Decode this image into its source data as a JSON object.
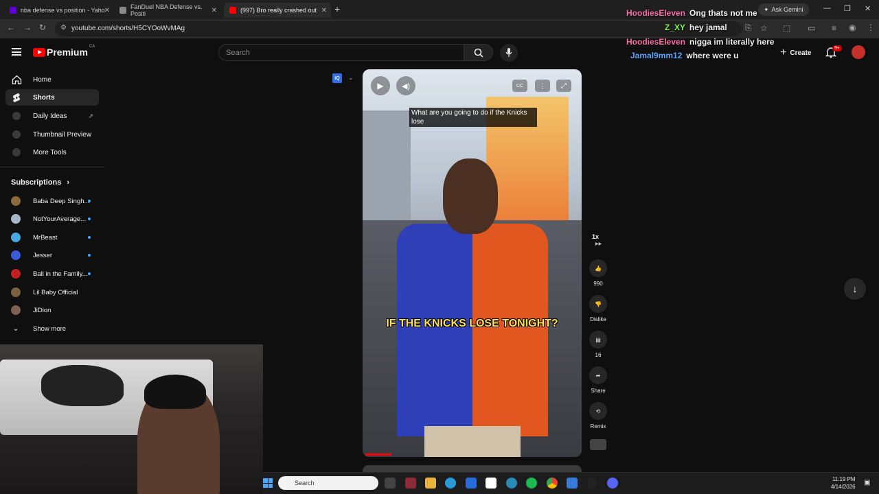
{
  "browser": {
    "tabs": [
      {
        "label": "nba defense vs position - Yaho",
        "color": "#6001d2"
      },
      {
        "label": "FanDuel NBA Defense vs. Positi",
        "color": "#888888"
      },
      {
        "label": "(997) Bro really crashed out",
        "color": "#ff0000"
      }
    ],
    "url": "youtube.com/shorts/H5CYOoWvMAg",
    "gemini_label": "Ask Gemini"
  },
  "youtube": {
    "logo_text": "Premium",
    "logo_region": "CA",
    "search_placeholder": "Search",
    "create_label": "Create",
    "notifications_badge": "9+",
    "nav_items": [
      {
        "label": "Home",
        "icon": "home-icon"
      },
      {
        "label": "Shorts",
        "icon": "shorts-icon"
      },
      {
        "label": "Daily Ideas",
        "icon": "vidiq-icon"
      },
      {
        "label": "Thumbnail Preview",
        "icon": "vidiq-icon"
      },
      {
        "label": "More Tools",
        "icon": "vidiq-icon"
      }
    ],
    "subscriptions_title": "Subscriptions",
    "subscriptions": [
      {
        "name": "Baba Deep Singh...",
        "color": "#8a6a3a"
      },
      {
        "name": "NotYourAverage...",
        "color": "#a8b4c8"
      },
      {
        "name": "MrBeast",
        "color": "#48a8e0"
      },
      {
        "name": "Jesser",
        "color": "#3a5ad8"
      },
      {
        "name": "Ball in the Family...",
        "color": "#c02020"
      },
      {
        "name": "Lil Baby Official",
        "color": "#7a6040"
      },
      {
        "name": "JiDion",
        "color": "#806050"
      }
    ],
    "show_more": "Show more",
    "video": {
      "caption_top": "What are you going to do if the Knicks lose",
      "caption_burned": "IF THE KNICKS LOSE TONIGHT?",
      "progress": 0.12
    },
    "actions": {
      "speed": "1x",
      "likes": "990",
      "dislike": "Dislike",
      "comments": "16",
      "share": "Share",
      "remix": "Remix"
    }
  },
  "chat": [
    {
      "name": "HoodiesEleven",
      "message": "Ong thats not me",
      "color": "#ff6ea8"
    },
    {
      "name": "Z_XY",
      "message": "hey jamal",
      "color": "#7cff4a"
    },
    {
      "name": "HoodiesEleven",
      "message": "nigga im literally here",
      "color": "#ff6ea8"
    },
    {
      "name": "Jamal9mm12",
      "message": "where were u",
      "color": "#5aa8ff"
    }
  ],
  "taskbar": {
    "search_label": "Search",
    "time": "11:19 PM",
    "date": "4/14/2026",
    "icons": [
      "file-explorer-icon",
      "app-icon",
      "folder-icon",
      "edge-icon",
      "store-icon",
      "nba-icon",
      "app-icon",
      "spotify-icon",
      "chrome-icon",
      "app-icon",
      "app-icon",
      "discord-icon"
    ]
  }
}
